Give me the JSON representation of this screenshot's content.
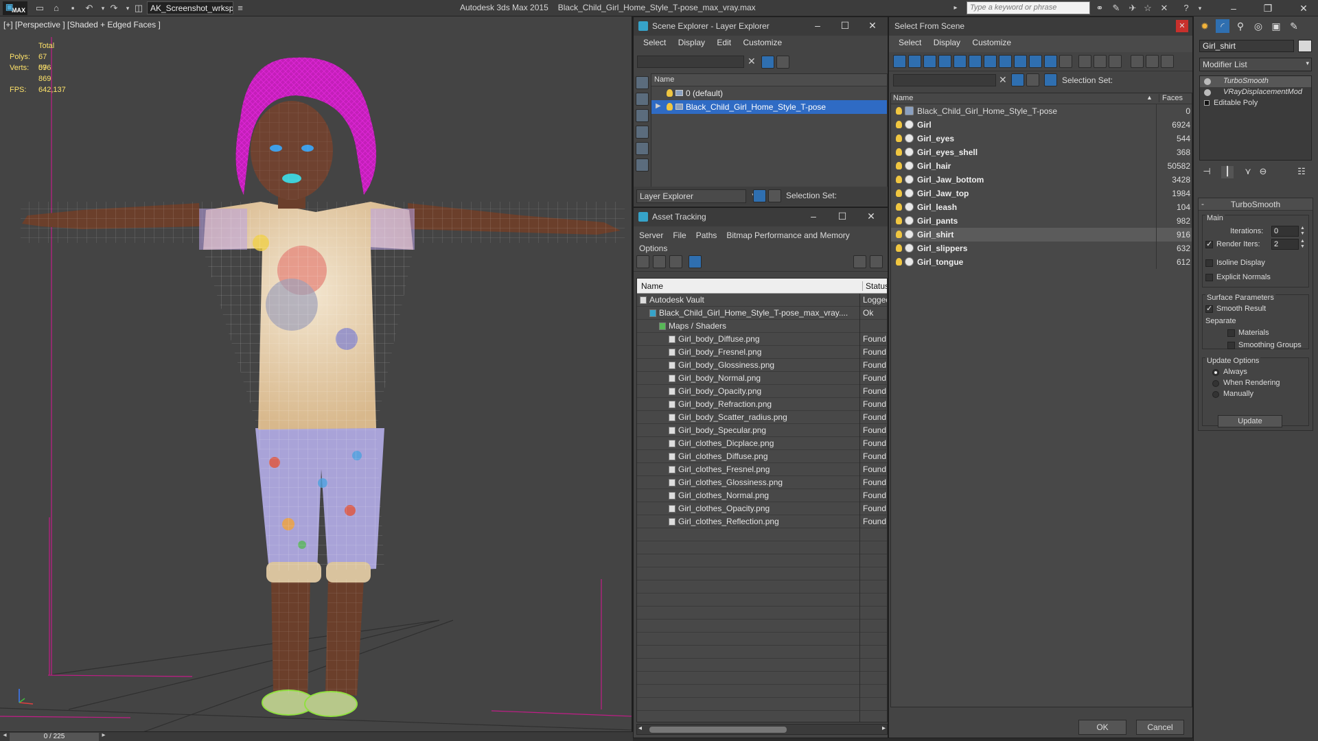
{
  "titlebar": {
    "logo": "MAX",
    "workspace": "AK_Screenshot_wrksp",
    "app_name": "Autodesk 3ds Max  2015",
    "file_name": "Black_Child_Girl_Home_Style_T-pose_max_vray.max",
    "search_placeholder": "Type a keyword or phrase"
  },
  "viewport": {
    "label": "[+] [Perspective ] [Shaded + Edged Faces ]",
    "stats": {
      "total_label": "Total",
      "polys_label": "Polys:",
      "polys": "67 076",
      "verts_label": "Verts:",
      "verts": "59 869",
      "fps_label": "FPS:",
      "fps": "642,137"
    },
    "time_slider": "0 / 225"
  },
  "scene_explorer": {
    "title": "Scene Explorer - Layer Explorer",
    "menu": [
      "Select",
      "Display",
      "Edit",
      "Customize"
    ],
    "column": "Name",
    "layers": [
      {
        "name": "0 (default)",
        "selected": false
      },
      {
        "name": "Black_Child_Girl_Home_Style_T-pose",
        "selected": true
      }
    ],
    "dropdown": "Layer Explorer",
    "selection_set": "Selection Set:"
  },
  "asset_tracking": {
    "title": "Asset Tracking",
    "menu_row1": [
      "Server",
      "File",
      "Paths",
      "Bitmap Performance and Memory"
    ],
    "menu_row2": [
      "Options"
    ],
    "col_name": "Name",
    "col_status": "Status",
    "rows": [
      {
        "name": "Autodesk Vault",
        "status": "Logged",
        "level": 1
      },
      {
        "name": "Black_Child_Girl_Home_Style_T-pose_max_vray....",
        "status": "Ok",
        "level": 2
      },
      {
        "name": "Maps / Shaders",
        "status": "",
        "level": 3
      },
      {
        "name": "Girl_body_Diffuse.png",
        "status": "Found",
        "level": 4
      },
      {
        "name": "Girl_body_Fresnel.png",
        "status": "Found",
        "level": 4
      },
      {
        "name": "Girl_body_Glossiness.png",
        "status": "Found",
        "level": 4
      },
      {
        "name": "Girl_body_Normal.png",
        "status": "Found",
        "level": 4
      },
      {
        "name": "Girl_body_Opacity.png",
        "status": "Found",
        "level": 4
      },
      {
        "name": "Girl_body_Refraction.png",
        "status": "Found",
        "level": 4
      },
      {
        "name": "Girl_body_Scatter_radius.png",
        "status": "Found",
        "level": 4
      },
      {
        "name": "Girl_body_Specular.png",
        "status": "Found",
        "level": 4
      },
      {
        "name": "Girl_clothes_Dicplace.png",
        "status": "Found",
        "level": 4
      },
      {
        "name": "Girl_clothes_Diffuse.png",
        "status": "Found",
        "level": 4
      },
      {
        "name": "Girl_clothes_Fresnel.png",
        "status": "Found",
        "level": 4
      },
      {
        "name": "Girl_clothes_Glossiness.png",
        "status": "Found",
        "level": 4
      },
      {
        "name": "Girl_clothes_Normal.png",
        "status": "Found",
        "level": 4
      },
      {
        "name": "Girl_clothes_Opacity.png",
        "status": "Found",
        "level": 4
      },
      {
        "name": "Girl_clothes_Reflection.png",
        "status": "Found",
        "level": 4
      }
    ]
  },
  "select_from_scene": {
    "title": "Select From Scene",
    "menu": [
      "Select",
      "Display",
      "Customize"
    ],
    "selection_set": "Selection Set:",
    "col_name": "Name",
    "col_faces": "Faces",
    "objects": [
      {
        "name": "Black_Child_Girl_Home_Style_T-pose",
        "faces": "0",
        "bold": false,
        "selected": false
      },
      {
        "name": "Girl",
        "faces": "6924",
        "bold": true,
        "selected": false
      },
      {
        "name": "Girl_eyes",
        "faces": "544",
        "bold": true,
        "selected": false
      },
      {
        "name": "Girl_eyes_shell",
        "faces": "368",
        "bold": true,
        "selected": false
      },
      {
        "name": "Girl_hair",
        "faces": "50582",
        "bold": true,
        "selected": false
      },
      {
        "name": "Girl_Jaw_bottom",
        "faces": "3428",
        "bold": true,
        "selected": false
      },
      {
        "name": "Girl_Jaw_top",
        "faces": "1984",
        "bold": true,
        "selected": false
      },
      {
        "name": "Girl_leash",
        "faces": "104",
        "bold": true,
        "selected": false
      },
      {
        "name": "Girl_pants",
        "faces": "982",
        "bold": true,
        "selected": false
      },
      {
        "name": "Girl_shirt",
        "faces": "916",
        "bold": true,
        "selected": true
      },
      {
        "name": "Girl_slippers",
        "faces": "632",
        "bold": true,
        "selected": false
      },
      {
        "name": "Girl_tongue",
        "faces": "612",
        "bold": true,
        "selected": false
      }
    ],
    "ok": "OK",
    "cancel": "Cancel"
  },
  "command_panel": {
    "object_name": "Girl_shirt",
    "modifier_list": "Modifier List",
    "stack": [
      {
        "name": "TurboSmooth",
        "italic": true
      },
      {
        "name": "VRayDisplacementMod",
        "italic": true
      },
      {
        "name": "Editable Poly",
        "italic": false
      }
    ],
    "turbosmooth": {
      "title": "TurboSmooth",
      "main": "Main",
      "iterations_label": "Iterations:",
      "iterations": "0",
      "render_iters_label": "Render Iters:",
      "render_iters": "2",
      "isoline": "Isoline Display",
      "explicit_normals": "Explicit Normals",
      "surface_params": "Surface Parameters",
      "smooth_result": "Smooth Result",
      "separate": "Separate",
      "materials": "Materials",
      "smoothing_groups": "Smoothing Groups",
      "update_options": "Update Options",
      "always": "Always",
      "when_rendering": "When Rendering",
      "manually": "Manually",
      "update": "Update"
    }
  },
  "colors": {
    "selection_blue": "#2f6bc4",
    "hair_wire": "#d21fc9",
    "stats_yellow": "#ffe36a"
  }
}
